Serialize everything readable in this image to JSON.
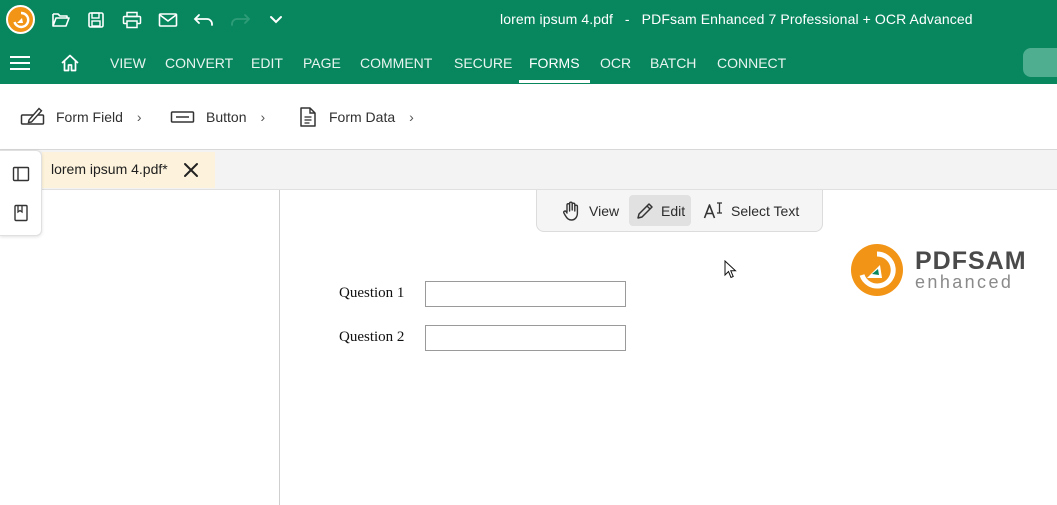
{
  "window": {
    "title": "lorem ipsum 4.pdf   -   PDFsam Enhanced 7 Professional + OCR Advanced"
  },
  "quick_access": {
    "icons": [
      "app-logo-icon",
      "open-folder-icon",
      "save-icon",
      "print-icon",
      "mail-icon",
      "undo-icon",
      "redo-icon",
      "chevron-down-icon"
    ]
  },
  "menu": {
    "items": [
      {
        "label": "VIEW"
      },
      {
        "label": "CONVERT"
      },
      {
        "label": "EDIT"
      },
      {
        "label": "PAGE"
      },
      {
        "label": "COMMENT"
      },
      {
        "label": "SECURE"
      },
      {
        "label": "FORMS"
      },
      {
        "label": "OCR"
      },
      {
        "label": "BATCH"
      },
      {
        "label": "CONNECT"
      }
    ],
    "active": "FORMS"
  },
  "ribbon": {
    "form_field": "Form Field",
    "button": "Button",
    "form_data": "Form Data"
  },
  "tab": {
    "name": "lorem ipsum 4.pdf*"
  },
  "mode_bar": {
    "view": "View",
    "edit": "Edit",
    "select_text": "Select Text",
    "active": "Edit"
  },
  "form": {
    "q1_label": "Question 1",
    "q1_value": "",
    "q2_label": "Question 2",
    "q2_value": ""
  },
  "brand": {
    "main_a": "PDF",
    "main_b": "SAM",
    "sub": "enhanced"
  },
  "colors": {
    "primary": "#08875f",
    "logo_orange": "#f29416",
    "tab_highlight": "#fdf3dc"
  }
}
